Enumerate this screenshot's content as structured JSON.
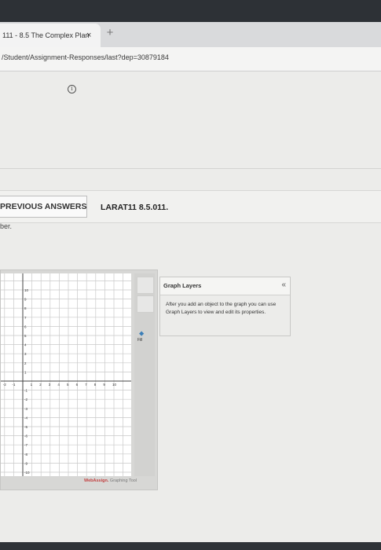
{
  "browser": {
    "tab_title": "111 - 8.5 The Complex Plan",
    "tab_close": "×",
    "new_tab": "+",
    "url": "/Student/Assignment-Responses/last?dep=30879184"
  },
  "question": {
    "previous_answers_label": "PREVIOUS ANSWERS",
    "question_id": "LARAT11 8.5.011.",
    "fragment": "ber."
  },
  "graph": {
    "y_labels": [
      "10",
      "9",
      "8",
      "7",
      "6",
      "5",
      "4",
      "3",
      "2",
      "1",
      "-1",
      "-2",
      "-3",
      "-4",
      "-5",
      "-6",
      "-7",
      "-8",
      "-9",
      "-10"
    ],
    "x_labels": [
      "-2",
      "-1",
      "1",
      "2",
      "3",
      "4",
      "5",
      "6",
      "7",
      "8",
      "9",
      "10"
    ],
    "fill_label": "Fill",
    "brand": "WebAssign.",
    "brand_suffix": " Graphing Tool"
  },
  "layers": {
    "title": "Graph Layers",
    "collapse": "«",
    "text": "After you add an object to the graph you can use Graph Layers to view and edit its properties."
  }
}
